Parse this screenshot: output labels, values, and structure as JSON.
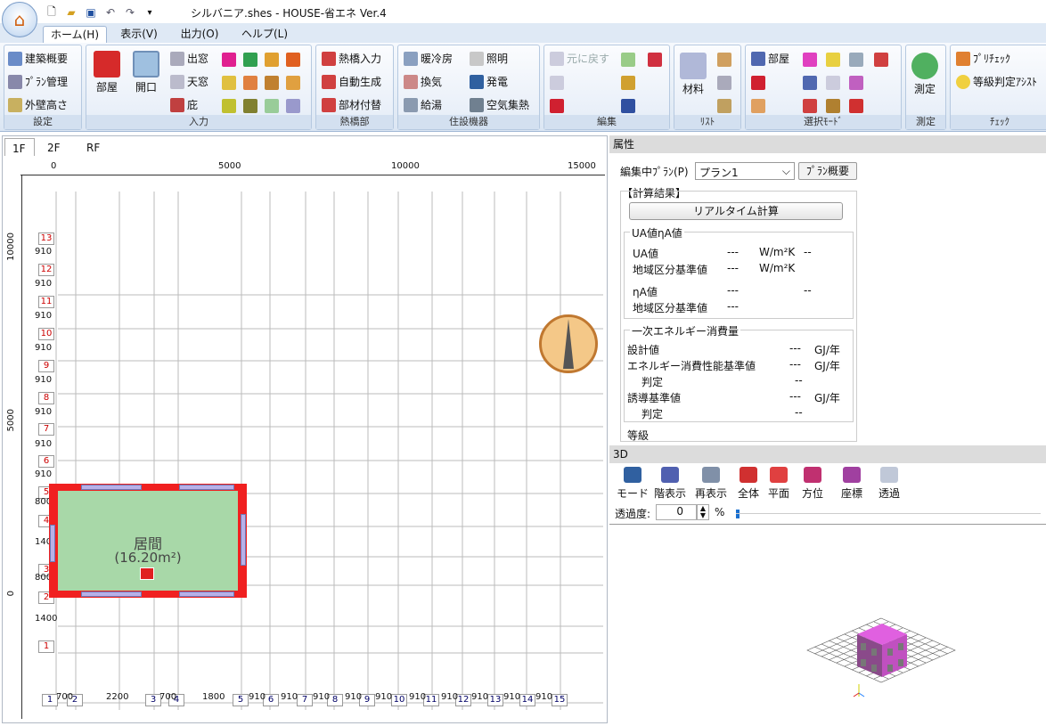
{
  "window": {
    "title": "シルバニア.shes - HOUSE-省エネ Ver.4"
  },
  "qat": {
    "icons": [
      "new-file-icon",
      "open-folder-icon",
      "save-icon",
      "undo-icon",
      "redo-icon"
    ],
    "more": "▾"
  },
  "ribbon": {
    "tabs": [
      {
        "label": "ホーム(H)"
      },
      {
        "label": "表示(V)"
      },
      {
        "label": "出力(O)"
      },
      {
        "label": "ヘルプ(L)"
      }
    ],
    "groups": {
      "settei": {
        "label": "設定",
        "items": [
          "建築概要",
          "ﾌﾟﾗﾝ管理",
          "外壁高さ"
        ]
      },
      "nyuryoku": {
        "label": "入力",
        "big": [
          "部屋",
          "開口"
        ],
        "items": [
          "出窓",
          "天窓",
          "庇"
        ]
      },
      "netsukyo": {
        "label": "熱橋部",
        "items": [
          "熱橋入力",
          "自動生成",
          "部材付替"
        ]
      },
      "jusetsu": {
        "label": "住設機器",
        "items": [
          "暖冷房",
          "照明",
          "換気",
          "発電",
          "給湯",
          "空気集熱"
        ]
      },
      "henshu": {
        "label": "編集",
        "items": [
          "元に戻す"
        ]
      },
      "list": {
        "label": "ﾘｽﾄ",
        "big": "材料"
      },
      "select": {
        "label": "選択ﾓｰﾄﾞ",
        "items": [
          "部屋"
        ]
      },
      "sokutei": {
        "label": "測定",
        "big": "測定"
      },
      "check": {
        "label": "ﾁｪｯｸ",
        "items": [
          "ﾌﾟﾘﾁｪｯｸ",
          "等級判定ｱｼｽﾄ"
        ]
      }
    }
  },
  "canvas": {
    "floor_tabs": [
      "1F",
      "2F",
      "RF"
    ],
    "ruler_top": [
      "0",
      "5000",
      "10000",
      "15000"
    ],
    "ruler_left": [
      "10000",
      "5000",
      "0"
    ],
    "row_grid_labels": [
      "13",
      "12",
      "11",
      "10",
      "9",
      "8",
      "7",
      "6",
      "5",
      "4",
      "3",
      "2",
      "1"
    ],
    "row_spacing_labels": [
      "910",
      "910",
      "910",
      "910",
      "910",
      "910",
      "910",
      "910",
      "800",
      "1400",
      "800",
      "1400"
    ],
    "col_grid_labels": [
      "1",
      "2",
      "3",
      "4",
      "5",
      "6",
      "7",
      "8",
      "9",
      "10",
      "11",
      "12",
      "13",
      "14",
      "15"
    ],
    "col_spacing_labels": [
      "700",
      "2200",
      "700",
      "1800",
      "910",
      "910",
      "910",
      "910",
      "910",
      "910",
      "910",
      "910",
      "910",
      "910"
    ],
    "room": {
      "name": "居間",
      "area": "(16.20m²)"
    }
  },
  "properties": {
    "header": "属性",
    "plan_label": "編集中ﾌﾟﾗﾝ(P)",
    "plan_value": "プラン1",
    "plan_overview_button": "ﾌﾟﾗﾝ概要",
    "calc_title": "【計算結果】",
    "realtime_button": "リアルタイム計算",
    "ua_section": "UA値ηA値",
    "ua_rows": [
      {
        "label": "UA値",
        "value": "---",
        "unit": "W/m²K",
        "judge": "--"
      },
      {
        "label": "地域区分基準値",
        "value": "---",
        "unit": "W/m²K",
        "judge": ""
      },
      {
        "label": "ηA値",
        "value": "---",
        "unit": "",
        "judge": "--"
      },
      {
        "label": "地域区分基準値",
        "value": "---",
        "unit": "",
        "judge": ""
      }
    ],
    "energy_section": "一次エネルギー消費量",
    "energy_rows": [
      {
        "label": "設計値",
        "value": "---",
        "unit": "GJ/年"
      },
      {
        "label": "エネルギー消費性能基準値",
        "value": "---",
        "unit": "GJ/年"
      },
      {
        "label": "判定",
        "value": "--",
        "unit": ""
      },
      {
        "label": "誘導基準値",
        "value": "---",
        "unit": "GJ/年"
      },
      {
        "label": "判定",
        "value": "--",
        "unit": ""
      }
    ],
    "grade_section": "等級"
  },
  "view3d": {
    "header": "3D",
    "tools": [
      "モード",
      "階表示",
      "再表示",
      "全体",
      "平面",
      "方位",
      "座標",
      "透過"
    ],
    "opacity_label": "透過度:",
    "opacity_value": "0",
    "opacity_unit": "%"
  }
}
